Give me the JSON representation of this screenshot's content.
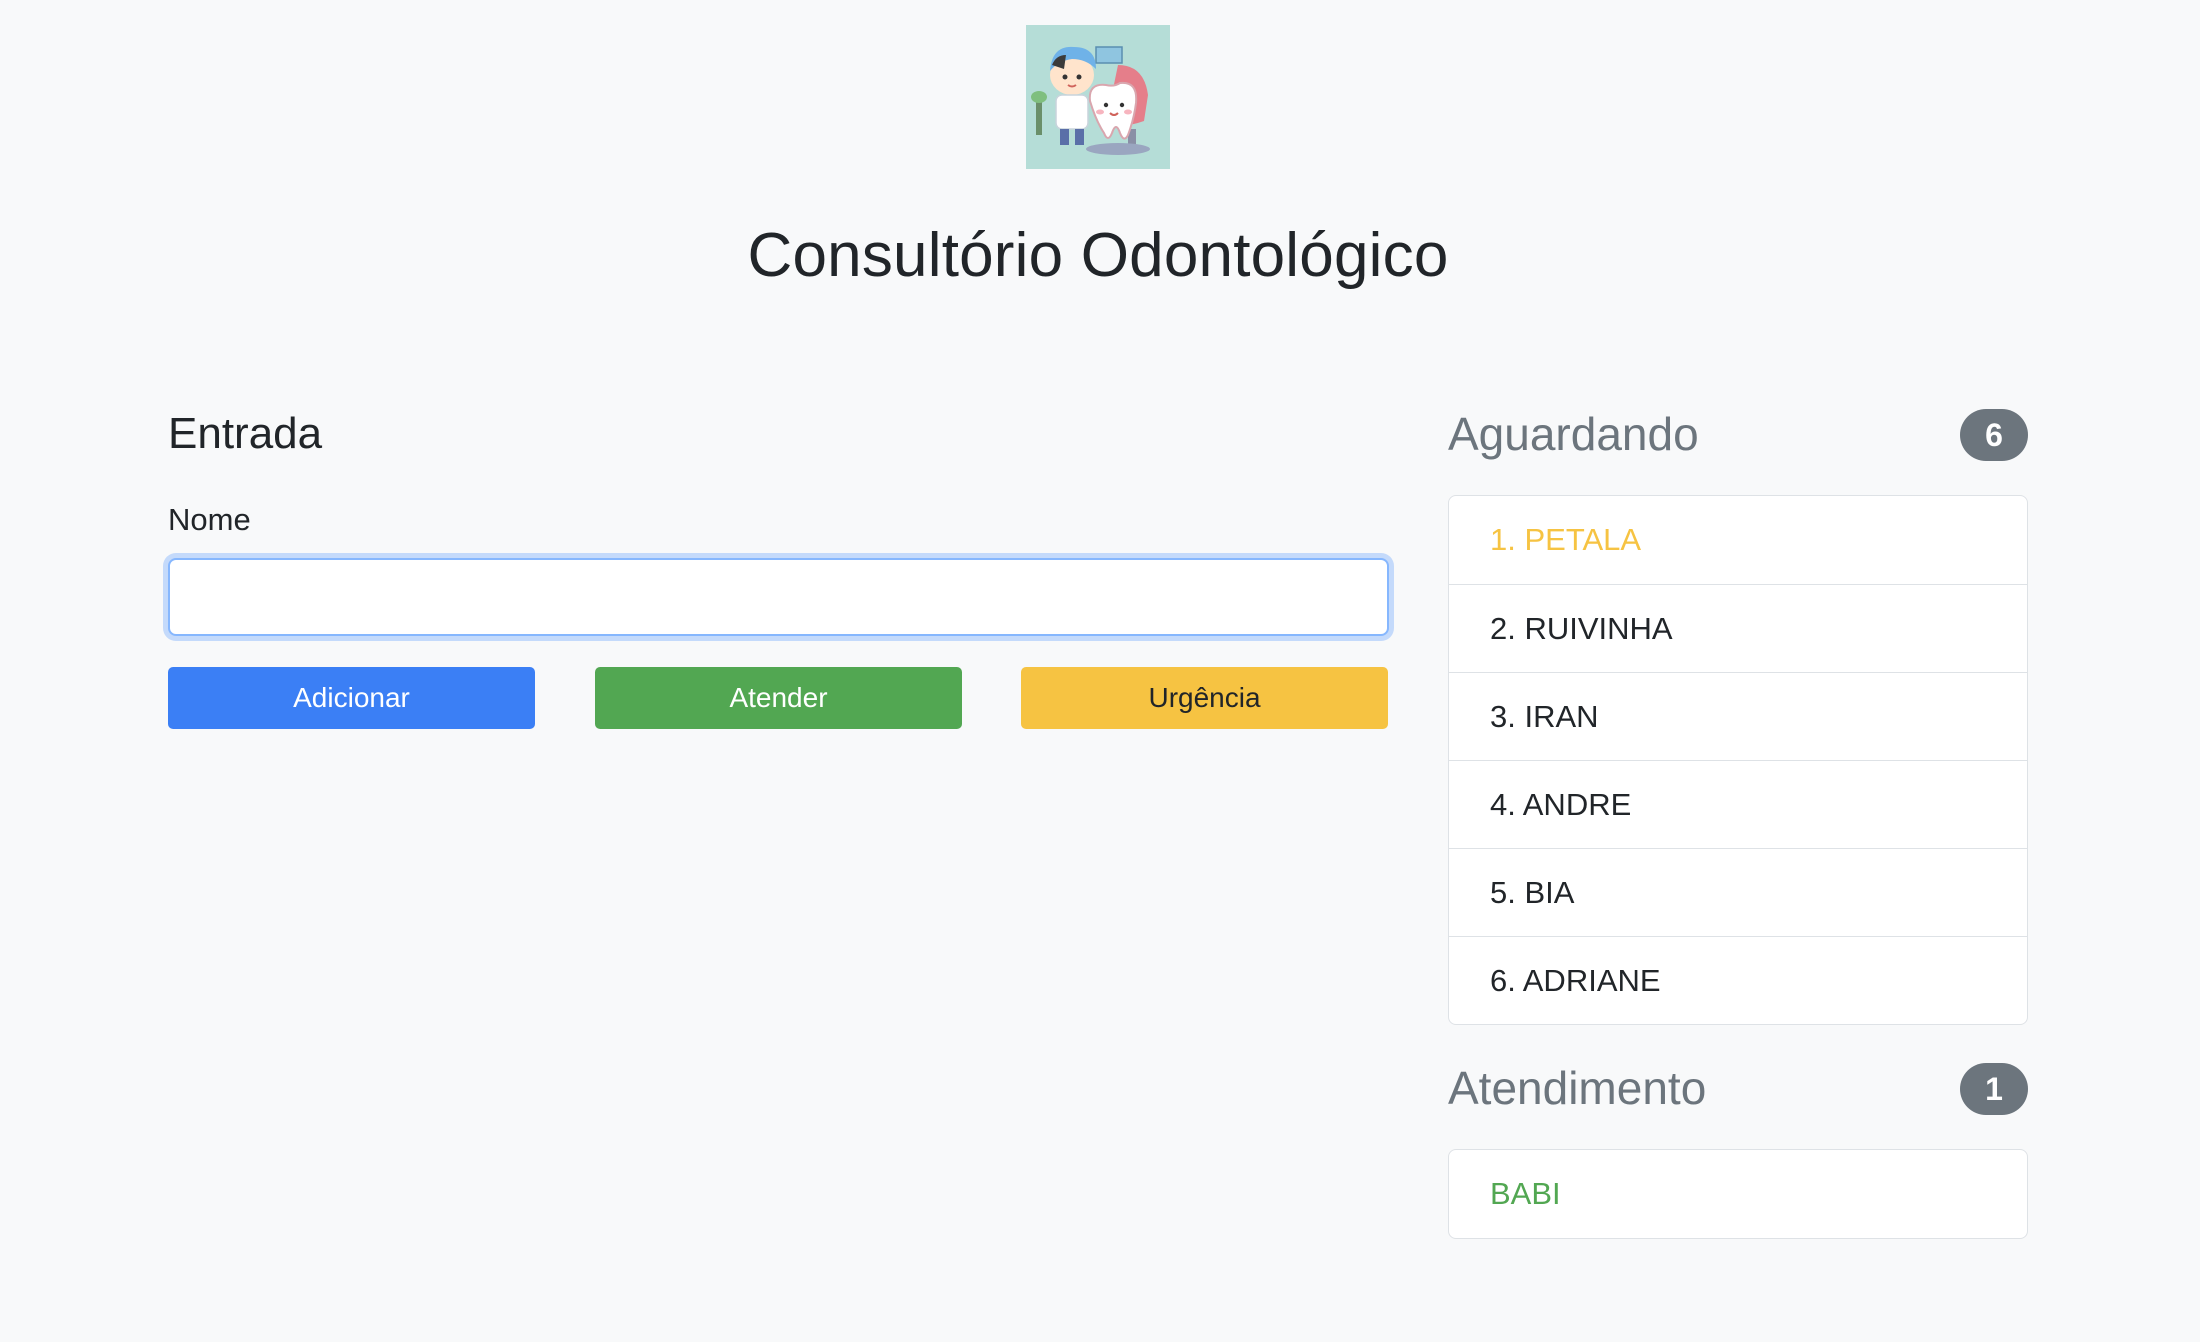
{
  "header": {
    "title": "Consultório Odontológico"
  },
  "entrada": {
    "heading": "Entrada",
    "name_label": "Nome",
    "name_value": "",
    "name_placeholder": "",
    "buttons": {
      "add": "Adicionar",
      "attend": "Atender",
      "urgent": "Urgência"
    }
  },
  "waiting": {
    "title": "Aguardando",
    "count": "6",
    "items": [
      "1. PETALA",
      "2. RUIVINHA",
      "3. IRAN",
      "4. ANDRE",
      "5. BIA",
      "6. ADRIANE"
    ]
  },
  "serving": {
    "title": "Atendimento",
    "count": "1",
    "items": [
      "BABI"
    ]
  },
  "colors": {
    "background": "#f8f9fa",
    "primary": "#3b7ff5",
    "success": "#52a752",
    "warning": "#f6c342",
    "secondary": "#6c757d"
  },
  "icons": {
    "logo": "dentist-and-tooth-logo"
  }
}
